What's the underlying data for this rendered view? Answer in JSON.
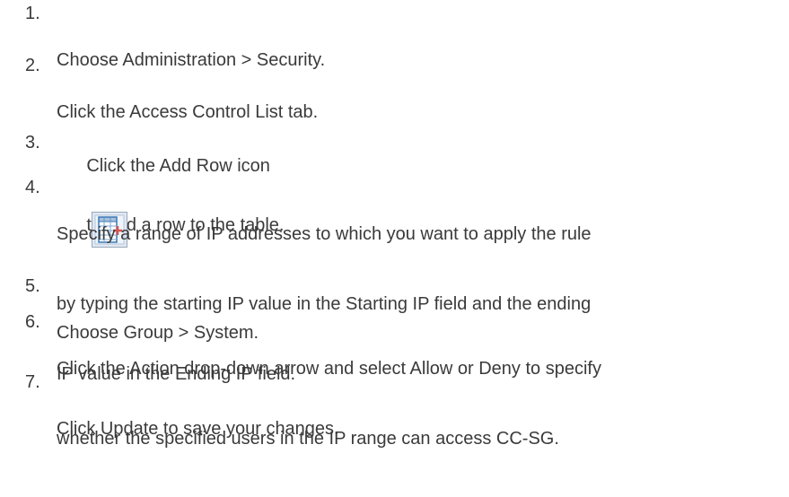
{
  "steps": [
    {
      "number": "1.",
      "lines": [
        "Choose Administration > Security."
      ]
    },
    {
      "number": "2.",
      "lines": [
        "Click the Access Control List tab."
      ]
    },
    {
      "number": "3.",
      "before_icon": "Click the Add Row icon",
      "icon": "add-row-icon",
      "after_icon": "to add a row to the table."
    },
    {
      "number": "4.",
      "lines": [
        "Specify a range of IP addresses to which you want to apply the rule",
        "by typing the starting IP value in the Starting IP field and the ending",
        "IP value in the Ending IP field."
      ]
    },
    {
      "number": "5.",
      "lines": [
        "Choose Group > System."
      ]
    },
    {
      "number": "6.",
      "lines": [
        "Click the Action drop-down arrow and select Allow or Deny to specify",
        "whether the specified users in the IP range can access CC-SG."
      ]
    },
    {
      "number": "7.",
      "lines": [
        "Click Update to save your changes."
      ]
    }
  ],
  "colors": {
    "text": "#3a3a3a",
    "icon_frame": "#3c78b4",
    "icon_grid": "#7aa7d6",
    "icon_plus": "#d9534f"
  }
}
